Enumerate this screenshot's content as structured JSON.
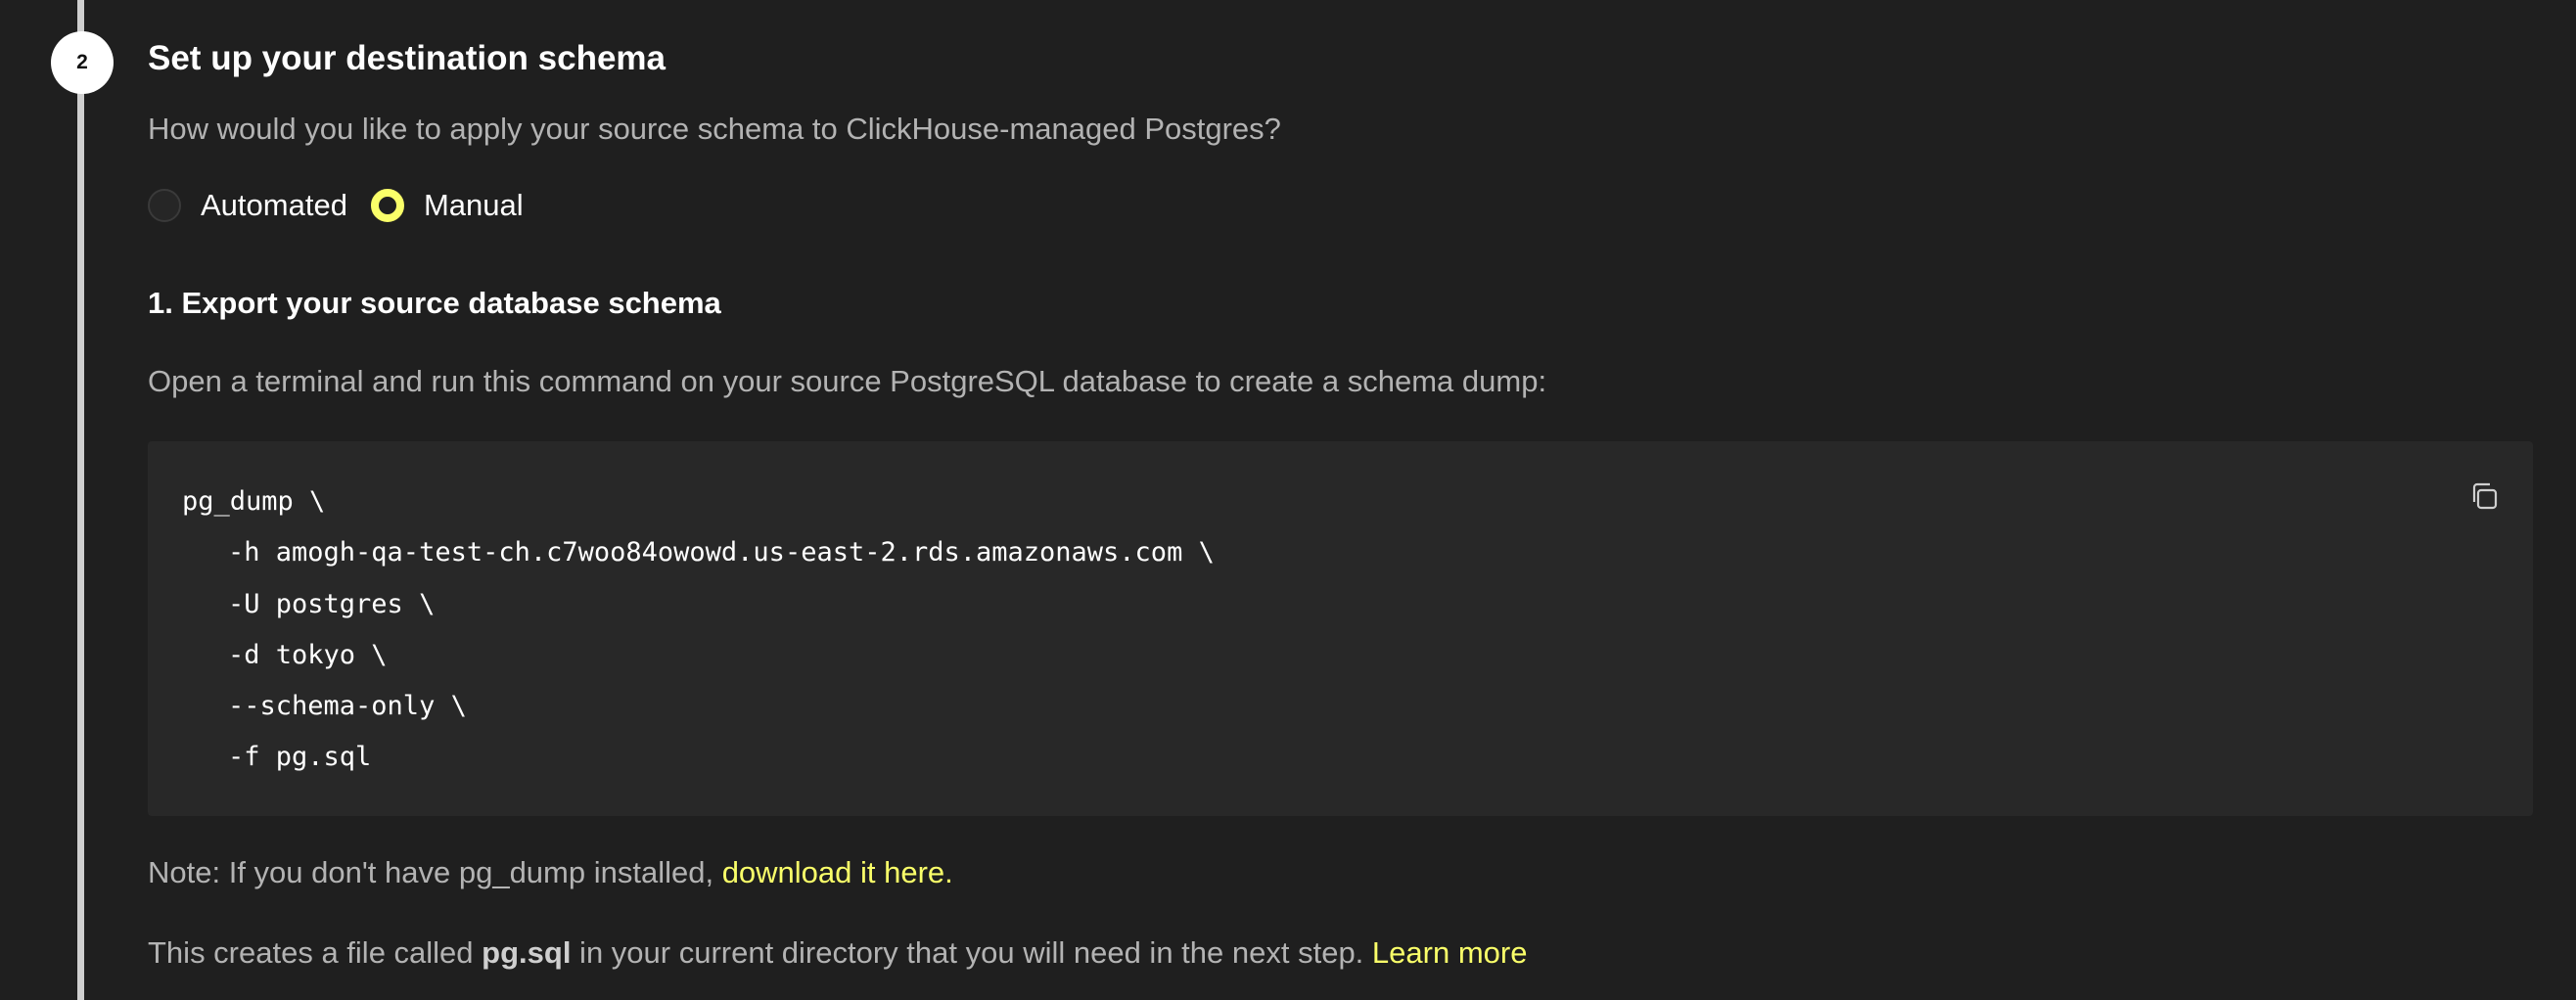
{
  "step": {
    "number": "2",
    "title": "Set up your destination schema",
    "question": "How would you like to apply your source schema to ClickHouse-managed Postgres?"
  },
  "radio_options": {
    "automated": {
      "label": "Automated",
      "selected": false
    },
    "manual": {
      "label": "Manual",
      "selected": true
    }
  },
  "export_section": {
    "heading": "1. Export your source database schema",
    "instruction": "Open a terminal and run this command on your source PostgreSQL database to create a schema dump:"
  },
  "code_block": {
    "lines": [
      "pg_dump \\",
      "-h amogh-qa-test-ch.c7woo84owowd.us-east-2.rds.amazonaws.com \\",
      "-U postgres \\",
      "-d tokyo \\",
      "--schema-only \\",
      "-f pg.sql"
    ],
    "copy_icon": "copy-icon"
  },
  "note": {
    "prefix": "Note: If you don't have pg_dump installed, ",
    "link": "download it here."
  },
  "file_note": {
    "prefix": "This creates a file called ",
    "filename": "pg.sql",
    "suffix": " in your current directory that you will need in the next step. ",
    "link": "Learn more"
  },
  "colors": {
    "background": "#1f1f1f",
    "accent": "#faff69",
    "code_background": "#282828",
    "muted_text": "#b3b3b3"
  }
}
